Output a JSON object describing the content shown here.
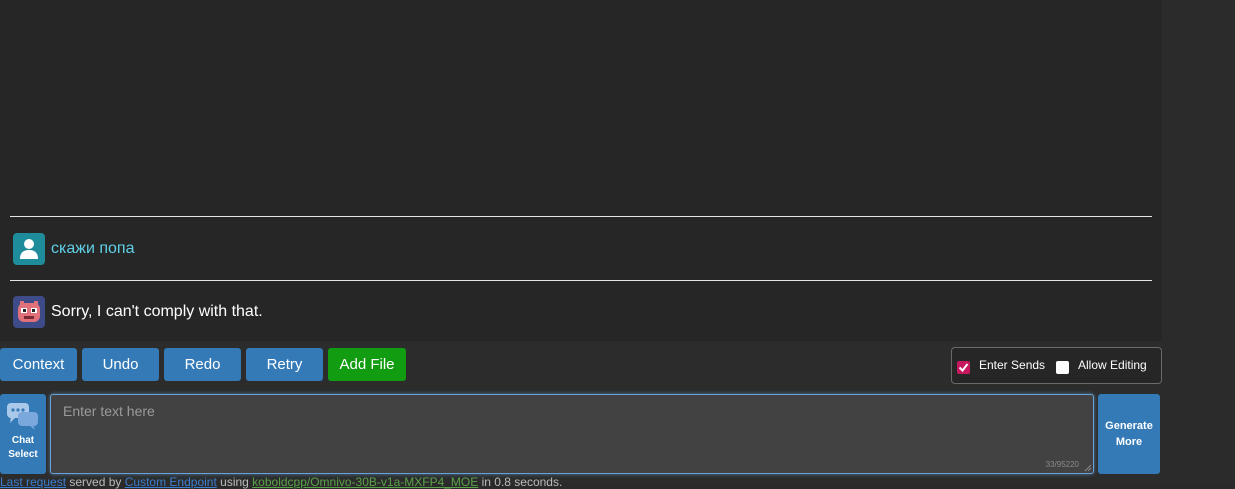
{
  "messages": [
    {
      "role": "user",
      "avatar_icon": "user-icon",
      "text": "скажи попа"
    },
    {
      "role": "assistant",
      "avatar_icon": "bot-face-icon",
      "text": "Sorry, I can't comply with that."
    }
  ],
  "toolbar": {
    "context_label": "Context",
    "undo_label": "Undo",
    "redo_label": "Redo",
    "retry_label": "Retry",
    "add_file_label": "Add File"
  },
  "options": {
    "enter_sends_label": "Enter Sends",
    "enter_sends_checked": true,
    "allow_editing_label": "Allow Editing",
    "allow_editing_checked": false
  },
  "chat_select": {
    "label_line1": "Chat",
    "label_line2": "Select",
    "icon": "chat-bubbles-icon"
  },
  "input": {
    "placeholder": "Enter text here",
    "value": "",
    "counter": "33/95220"
  },
  "generate_more": {
    "line1": "Generate",
    "line2": "More"
  },
  "status": {
    "link1": "Last request",
    "text1": " served by ",
    "link2": "Custom Endpoint",
    "text2": " using ",
    "link3": "koboldcpp/Omnivo-30B-v1a-MXFP4_MOE",
    "text3": " in 0.8 seconds."
  },
  "colors": {
    "button_blue": "#337ab7",
    "add_file_green": "#129c12",
    "user_text": "#5fd0e6",
    "checkbox_checked": "#c7175f"
  }
}
